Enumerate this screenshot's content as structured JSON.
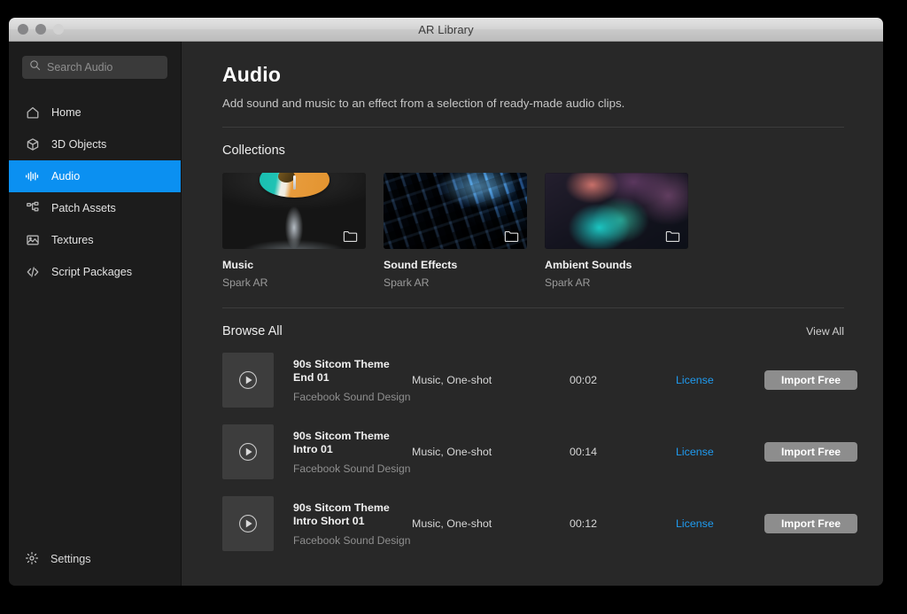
{
  "window": {
    "title": "AR Library",
    "traffic_lights": [
      "close-button",
      "minimize-button",
      "zoom-button"
    ]
  },
  "sidebar": {
    "search": {
      "placeholder": "Search Audio",
      "value": "",
      "icon": "search-icon"
    },
    "items": [
      {
        "label": "Home",
        "icon": "home-icon",
        "active": false
      },
      {
        "label": "3D Objects",
        "icon": "cube-icon",
        "active": false
      },
      {
        "label": "Audio",
        "icon": "waveform-icon",
        "active": true
      },
      {
        "label": "Patch Assets",
        "icon": "patch-graph-icon",
        "active": false
      },
      {
        "label": "Textures",
        "icon": "image-icon",
        "active": false
      },
      {
        "label": "Script Packages",
        "icon": "code-brackets-icon",
        "active": false
      }
    ],
    "settings": {
      "label": "Settings",
      "icon": "gear-icon"
    }
  },
  "main": {
    "title": "Audio",
    "subtitle": "Add sound and music to an effect from a selection of ready-made audio clips.",
    "collections": {
      "heading": "Collections",
      "cards": [
        {
          "name": "Music",
          "author": "Spark AR",
          "art": "vinyl-record-artwork",
          "badge": "folder-icon"
        },
        {
          "name": "Sound Effects",
          "author": "Spark AR",
          "art": "mixing-desk-artwork",
          "badge": "folder-icon"
        },
        {
          "name": "Ambient Sounds",
          "author": "Spark AR",
          "art": "ambient-blur-artwork",
          "badge": "folder-icon"
        }
      ]
    },
    "browse_all": {
      "heading": "Browse All",
      "view_all": "View All",
      "tracks": [
        {
          "title_line1": "90s Sitcom Theme",
          "title_line2": "End 01",
          "author": "Facebook Sound Design",
          "tags": "Music, One-shot",
          "duration": "00:02",
          "license": "License",
          "action": "Import Free"
        },
        {
          "title_line1": "90s Sitcom Theme",
          "title_line2": "Intro 01",
          "author": "Facebook Sound Design",
          "tags": "Music, One-shot",
          "duration": "00:14",
          "license": "License",
          "action": "Import Free"
        },
        {
          "title_line1": "90s Sitcom Theme",
          "title_line2": "Intro Short 01",
          "author": "Facebook Sound Design",
          "tags": "Music, One-shot",
          "duration": "00:12",
          "license": "License",
          "action": "Import Free"
        }
      ]
    }
  },
  "colors": {
    "accent": "#0b90f1",
    "link": "#1f9bf0",
    "sidebar_bg": "#1c1c1c",
    "main_bg": "#282828",
    "button_bg": "#8d8d8d"
  }
}
